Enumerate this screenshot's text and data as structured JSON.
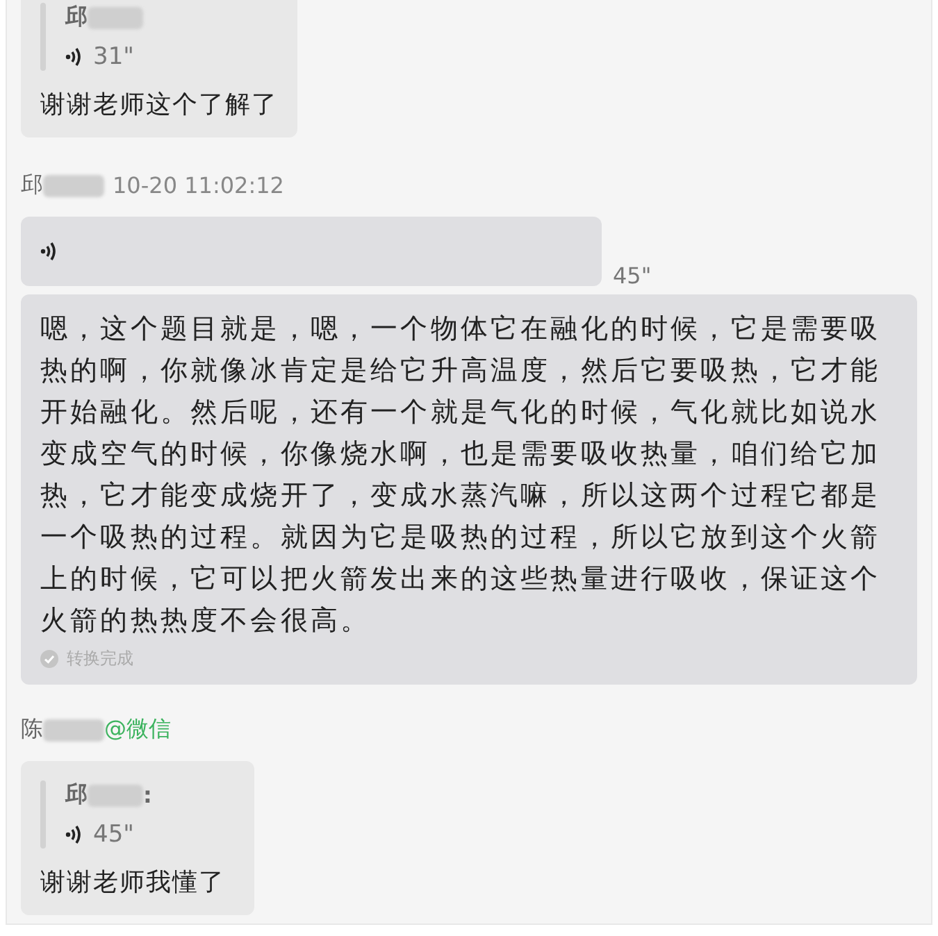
{
  "messages": [
    {
      "kind": "reply",
      "quote_sender": "邱",
      "quote_duration": "31\"",
      "text": "谢谢老师这个了解了"
    },
    {
      "kind": "header",
      "sender": "邱",
      "time": "10-20 11:02:12"
    },
    {
      "kind": "voice",
      "duration": "45\""
    },
    {
      "kind": "transcript",
      "text": "嗯，这个题目就是，嗯，一个物体它在融化的时候，它是需要吸热的啊，你就像冰肯定是给它升高温度，然后它要吸热，它才能开始融化。然后呢，还有一个就是气化的时候，气化就比如说水变成空气的时候，你像烧水啊，也是需要吸收热量，咱们给它加热，它才能变成烧开了，变成水蒸汽嘛，所以这两个过程它都是一个吸热的过程。就因为它是吸热的过程，所以它放到这个火箭上的时候，它可以把火箭发出来的这些热量进行吸收，保证这个火箭的热热度不会很高。",
      "status": "转换完成"
    },
    {
      "kind": "header",
      "sender": "陈",
      "source": "@微信"
    },
    {
      "kind": "reply",
      "quote_sender": "邱",
      "quote_suffix": ":",
      "quote_duration": "45\"",
      "text": "谢谢老师我懂了"
    }
  ]
}
